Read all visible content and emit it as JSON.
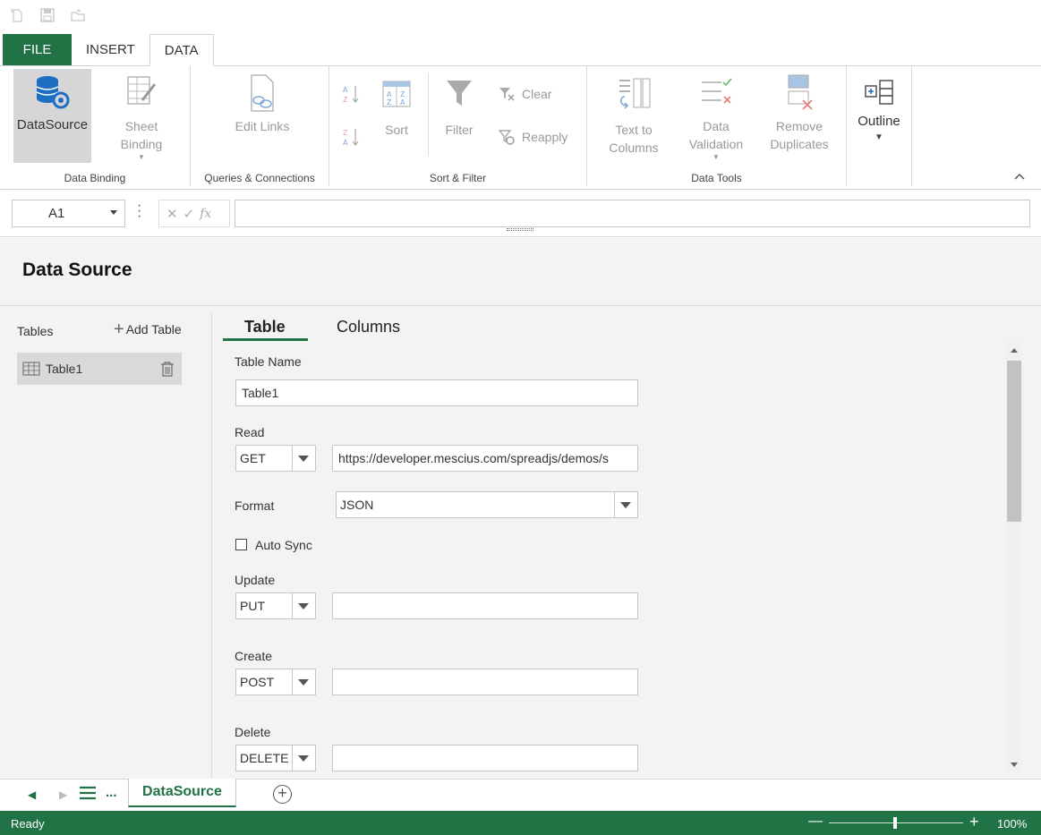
{
  "quick_access": {
    "icons": [
      "new-document-icon",
      "save-icon",
      "open-folder-icon"
    ]
  },
  "tabs": [
    {
      "label": "FILE"
    },
    {
      "label": "INSERT"
    },
    {
      "label": "DATA"
    }
  ],
  "ribbon": {
    "data_binding": {
      "label": "Data Binding",
      "datasource": "DataSource",
      "sheet_binding_1": "Sheet",
      "sheet_binding_2": "Binding"
    },
    "queries": {
      "label": "Queries & Connections",
      "edit_links": "Edit Links"
    },
    "sort_filter": {
      "label": "Sort & Filter",
      "sort": "Sort",
      "filter": "Filter",
      "clear": "Clear",
      "reapply": "Reapply"
    },
    "data_tools": {
      "label": "Data Tools",
      "text_to_columns_1": "Text to",
      "text_to_columns_2": "Columns",
      "data_validation_1": "Data",
      "data_validation_2": "Validation",
      "remove_duplicates_1": "Remove",
      "remove_duplicates_2": "Duplicates"
    },
    "outline": {
      "label": "Outline"
    }
  },
  "formula_bar": {
    "name_box": "A1",
    "formula": ""
  },
  "panel": {
    "title": "Data Source",
    "tables_label": "Tables",
    "add_table": "Add Table",
    "tables": [
      {
        "name": "Table1"
      }
    ],
    "tabs": [
      "Table",
      "Columns"
    ],
    "form": {
      "table_name_label": "Table Name",
      "table_name_value": "Table1",
      "read_label": "Read",
      "read_method": "GET",
      "read_url": "https://developer.mescius.com/spreadjs/demos/s",
      "format_label": "Format",
      "format_value": "JSON",
      "auto_sync_label": "Auto Sync",
      "auto_sync_checked": false,
      "update_label": "Update",
      "update_method": "PUT",
      "update_url": "",
      "create_label": "Create",
      "create_method": "POST",
      "create_url": "",
      "delete_label": "Delete",
      "delete_method": "DELETE",
      "delete_url": ""
    }
  },
  "sheets": {
    "active": "DataSource",
    "more": "..."
  },
  "status": {
    "text": "Ready",
    "zoom": "100%"
  },
  "colors": {
    "accent": "#217346"
  }
}
